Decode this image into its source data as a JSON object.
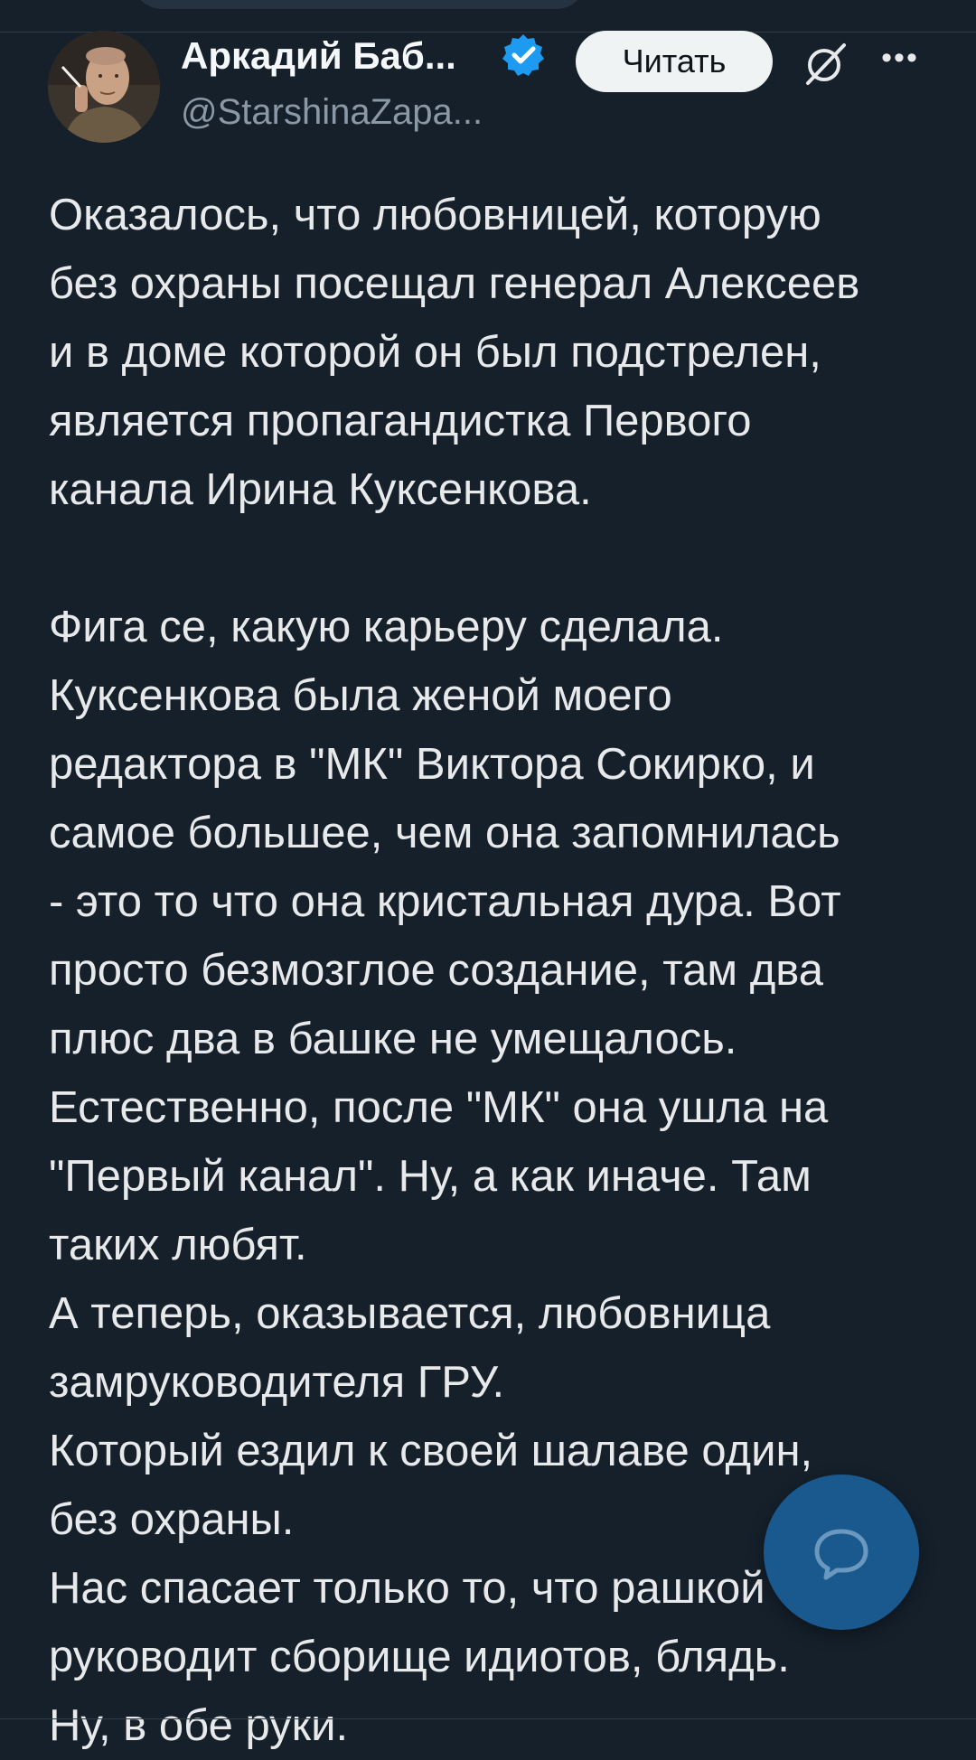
{
  "author": {
    "display_name": "Аркадий Баб...",
    "handle": "@StarshinaZapa...",
    "verified": true,
    "avatar_icon": "user-avatar"
  },
  "actions": {
    "follow_label": "Читать",
    "grok_icon": "grok-icon",
    "more_icon": "more-horizontal-icon"
  },
  "tweet": {
    "paragraphs": [
      {
        "lines": [
          "Оказалось, что любовницей, которую",
          "без охраны посещал генерал Алексеев",
          "и в доме которой он был подстрелен,",
          "является пропагандистка Первого",
          "канала Ирина Куксенкова."
        ]
      },
      {
        "lines": [
          "Фига се, какую карьеру сделала.",
          "Куксенкова была женой моего",
          "редактора в \"МК\" Виктора Сокирко, и",
          "самое большее, чем она запомнилась",
          "- это то что она кристальная дура. Вот",
          "просто безмозглое создание, там два",
          "плюс два в башке не умещалось.",
          "Естественно, после \"МК\" она ушла на",
          "\"Первый канал\". Ну, а как иначе. Там",
          "таких любят.",
          "А теперь, оказывается, любовница",
          "замруководителя ГРУ.",
          "Который ездил к своей шалаве один,",
          "без охраны.",
          "Нас спасает только то, что рашкой",
          "руководит сборище идиотов, блядь.",
          "Ну, в обе руки."
        ]
      }
    ]
  },
  "fab": {
    "icon": "reply-bubble-icon"
  },
  "colors": {
    "background": "#15202b",
    "text": "#e7e9ea",
    "secondary_text": "#8b98a5",
    "verified_blue": "#1d9bf0",
    "follow_button_bg": "#eff3f4",
    "fab_bg": "#1d6fb4"
  }
}
